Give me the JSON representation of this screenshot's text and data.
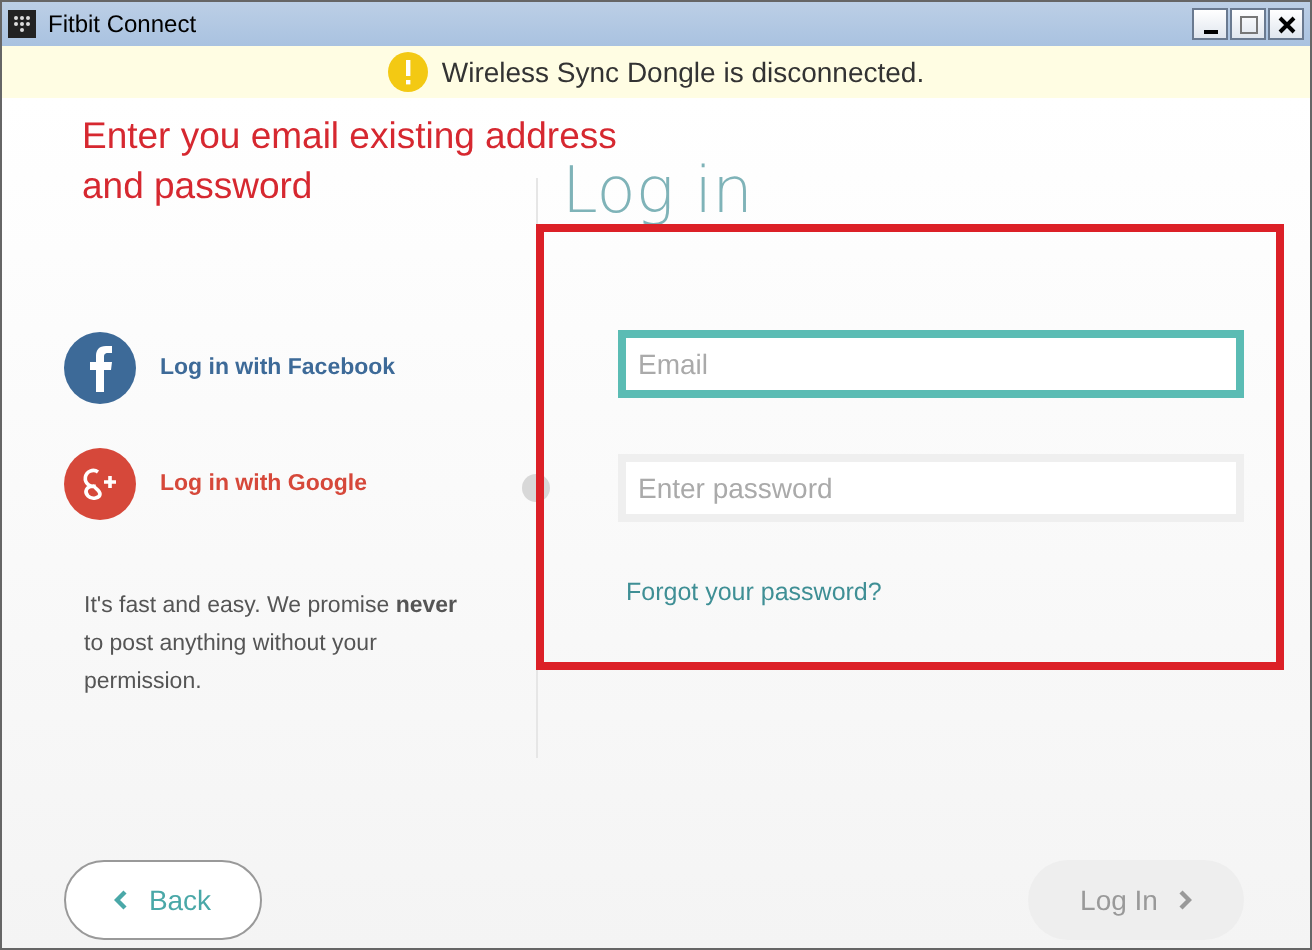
{
  "window": {
    "title": "Fitbit Connect"
  },
  "banner": {
    "message": "Wireless Sync Dongle is disconnected."
  },
  "annotation": {
    "lines": [
      "Enter you email existing address",
      "and password"
    ]
  },
  "social_logins": [
    {
      "kind": "facebook",
      "label": "Log in with Facebook"
    },
    {
      "kind": "google",
      "label": "Log in with Google"
    }
  ],
  "privacy_note": "It's fast and easy. We promise **never** to post anything without your permission.",
  "login": {
    "heading": "Log in",
    "email": {
      "placeholder": "Email",
      "focused": true
    },
    "password": {
      "placeholder": "Enter password",
      "focused": false
    },
    "forgot_link": "Forgot your password?"
  },
  "buttons": {
    "back": "Back",
    "login": {
      "label": "Log In",
      "disabled": true
    }
  }
}
